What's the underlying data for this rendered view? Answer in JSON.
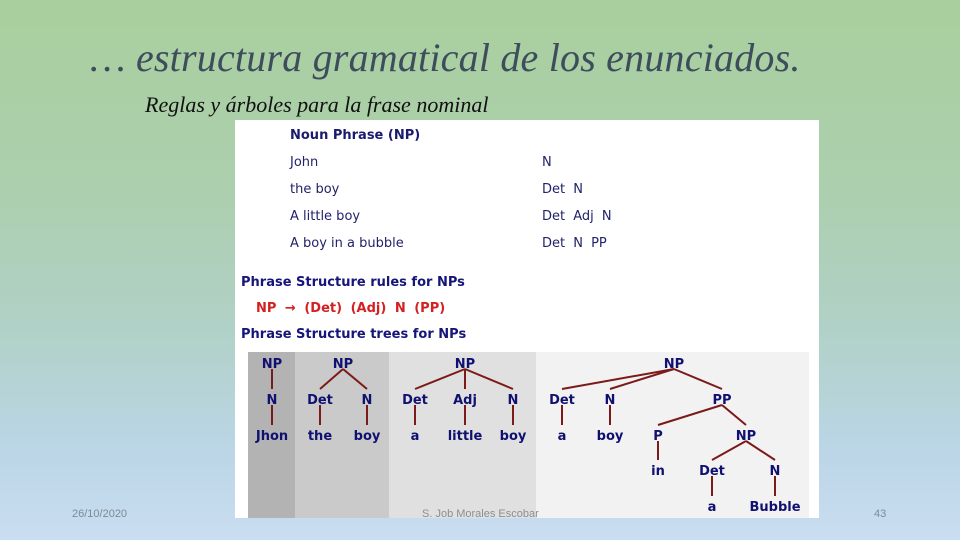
{
  "slide": {
    "title": "… estructura gramatical de los enunciados.",
    "subtitle": "Reglas y árboles para la frase nominal",
    "footer": {
      "date": "26/10/2020",
      "author": "S. Job Morales Escobar",
      "page_number": "43"
    }
  },
  "figure": {
    "table_title": "Noun Phrase (NP)",
    "rows": [
      {
        "example": "John",
        "structure": "N"
      },
      {
        "example": "the boy",
        "structure": "Det N"
      },
      {
        "example": "A little boy",
        "structure": "Det Adj N"
      },
      {
        "example": "A boy in a bubble",
        "structure": "Det N PP"
      }
    ],
    "rules_heading": "Phrase Structure rules for NPs",
    "rule": "NP → (Det) (Adj) N (PP)",
    "trees_heading": "Phrase Structure trees for NPs",
    "colors": {
      "node_text": "#101070",
      "branch_line": "#7a1a1a",
      "rule_text": "#d42020"
    },
    "trees": [
      {
        "nodes": [
          {
            "id": "np",
            "label": "NP"
          },
          {
            "id": "n",
            "label": "N"
          },
          {
            "id": "w1",
            "label": "Jhon"
          }
        ],
        "edges": [
          [
            "np",
            "n"
          ],
          [
            "n",
            "w1"
          ]
        ]
      },
      {
        "nodes": [
          {
            "id": "np",
            "label": "NP"
          },
          {
            "id": "det",
            "label": "Det"
          },
          {
            "id": "n",
            "label": "N"
          },
          {
            "id": "w1",
            "label": "the"
          },
          {
            "id": "w2",
            "label": "boy"
          }
        ],
        "edges": [
          [
            "np",
            "det"
          ],
          [
            "np",
            "n"
          ],
          [
            "det",
            "w1"
          ],
          [
            "n",
            "w2"
          ]
        ]
      },
      {
        "nodes": [
          {
            "id": "np",
            "label": "NP"
          },
          {
            "id": "det",
            "label": "Det"
          },
          {
            "id": "adj",
            "label": "Adj"
          },
          {
            "id": "n",
            "label": "N"
          },
          {
            "id": "w1",
            "label": "a"
          },
          {
            "id": "w2",
            "label": "little"
          },
          {
            "id": "w3",
            "label": "boy"
          }
        ],
        "edges": [
          [
            "np",
            "det"
          ],
          [
            "np",
            "adj"
          ],
          [
            "np",
            "n"
          ],
          [
            "det",
            "w1"
          ],
          [
            "adj",
            "w2"
          ],
          [
            "n",
            "w3"
          ]
        ]
      },
      {
        "nodes": [
          {
            "id": "np",
            "label": "NP"
          },
          {
            "id": "det",
            "label": "Det"
          },
          {
            "id": "n",
            "label": "N"
          },
          {
            "id": "pp",
            "label": "PP"
          },
          {
            "id": "w1",
            "label": "a"
          },
          {
            "id": "w2",
            "label": "boy"
          },
          {
            "id": "p",
            "label": "P"
          },
          {
            "id": "np2",
            "label": "NP"
          },
          {
            "id": "w3",
            "label": "in"
          },
          {
            "id": "det2",
            "label": "Det"
          },
          {
            "id": "n2",
            "label": "N"
          },
          {
            "id": "w4",
            "label": "a"
          },
          {
            "id": "w5",
            "label": "Bubble"
          }
        ],
        "edges": [
          [
            "np",
            "det"
          ],
          [
            "np",
            "n"
          ],
          [
            "np",
            "pp"
          ],
          [
            "det",
            "w1"
          ],
          [
            "n",
            "w2"
          ],
          [
            "pp",
            "p"
          ],
          [
            "pp",
            "np2"
          ],
          [
            "p",
            "w3"
          ],
          [
            "np2",
            "det2"
          ],
          [
            "np2",
            "n2"
          ],
          [
            "det2",
            "w4"
          ],
          [
            "n2",
            "w5"
          ]
        ]
      }
    ]
  }
}
